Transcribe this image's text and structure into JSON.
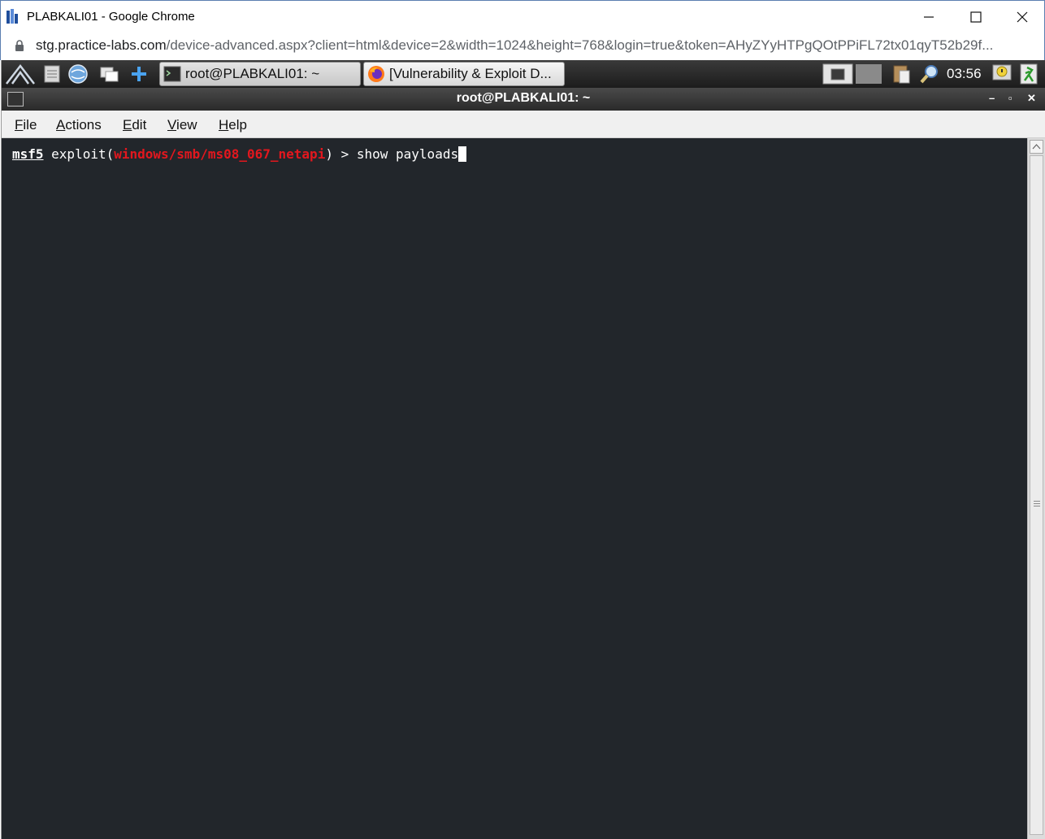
{
  "window": {
    "title": "PLABKALI01 - Google Chrome"
  },
  "address_bar": {
    "host": "stg.practice-labs.com",
    "path": "/device-advanced.aspx?client=html&device=2&width=1024&height=768&login=true&token=AHyZYyHTPgQOtPPiFL72tx01qyT52b29f..."
  },
  "taskbar": {
    "tasks": [
      {
        "label": "root@PLABKALI01: ~",
        "icon": "terminal-icon"
      },
      {
        "label": "[Vulnerability & Exploit D...",
        "icon": "firefox-icon"
      }
    ],
    "clock": "03:56"
  },
  "terminal": {
    "title": "root@PLABKALI01: ~",
    "menu": {
      "file": {
        "u": "F",
        "rest": "ile"
      },
      "actions": {
        "u": "A",
        "rest": "ctions"
      },
      "edit": {
        "u": "E",
        "rest": "dit"
      },
      "view": {
        "u": "V",
        "rest": "iew"
      },
      "help": {
        "u": "H",
        "rest": "elp"
      }
    },
    "prompt": "msf5",
    "exploit_prefix": " exploit(",
    "module": "windows/smb/ms08_067_netapi",
    "exploit_suffix": ") > ",
    "command": "show payloads"
  },
  "colors": {
    "terminal_bg": "#22262b",
    "module_red": "#e3171e"
  }
}
